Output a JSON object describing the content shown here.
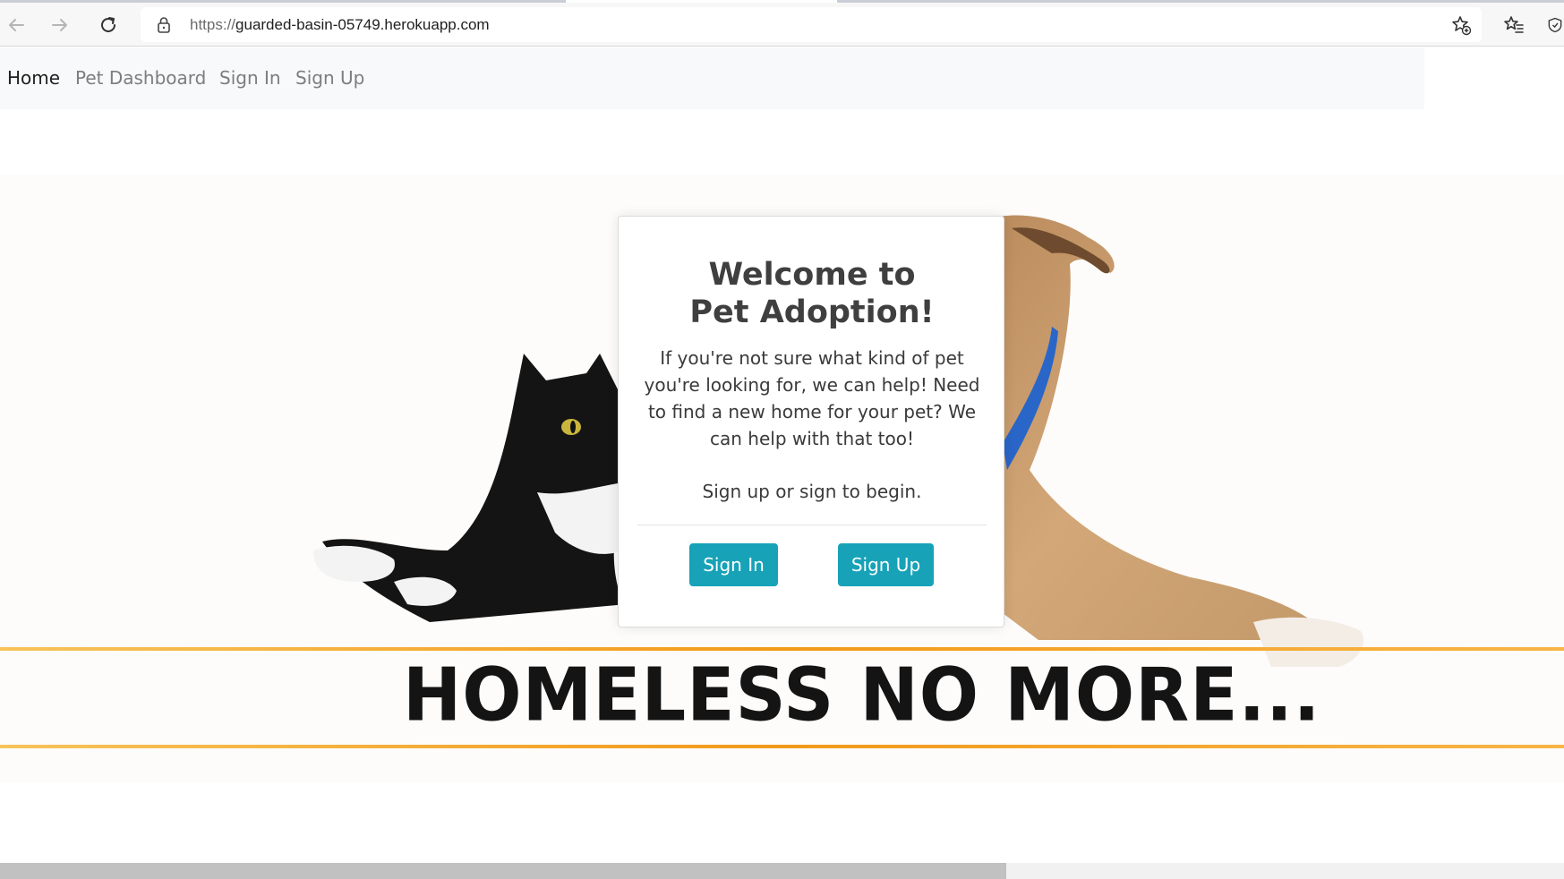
{
  "browser": {
    "url_scheme": "https://",
    "url_host": "guarded-basin-05749.herokuapp.com",
    "icons": [
      "back-arrow-icon",
      "forward-arrow-icon",
      "reload-icon",
      "lock-icon",
      "add-favorite-icon",
      "favorites-icon",
      "browser-essentials-icon"
    ]
  },
  "nav": {
    "home": "Home",
    "dashboard": "Pet Dashboard",
    "signin": "Sign In",
    "signup": "Sign Up"
  },
  "card": {
    "title_line1": "Welcome to",
    "title_line2": "Pet Adoption!",
    "body": "If you're not sure what kind of pet you're looking for, we can help! Need to find a new home for your pet? We can help with that too!",
    "prompt": "Sign up or sign to begin.",
    "signin_button": "Sign In",
    "signup_button": "Sign Up"
  },
  "hero": {
    "banner": "HOMELESS NO MORE..."
  },
  "colors": {
    "accent": "#17a2b8",
    "banner_orange": "#f39a1e",
    "navbar_bg": "#f8f9fa"
  }
}
